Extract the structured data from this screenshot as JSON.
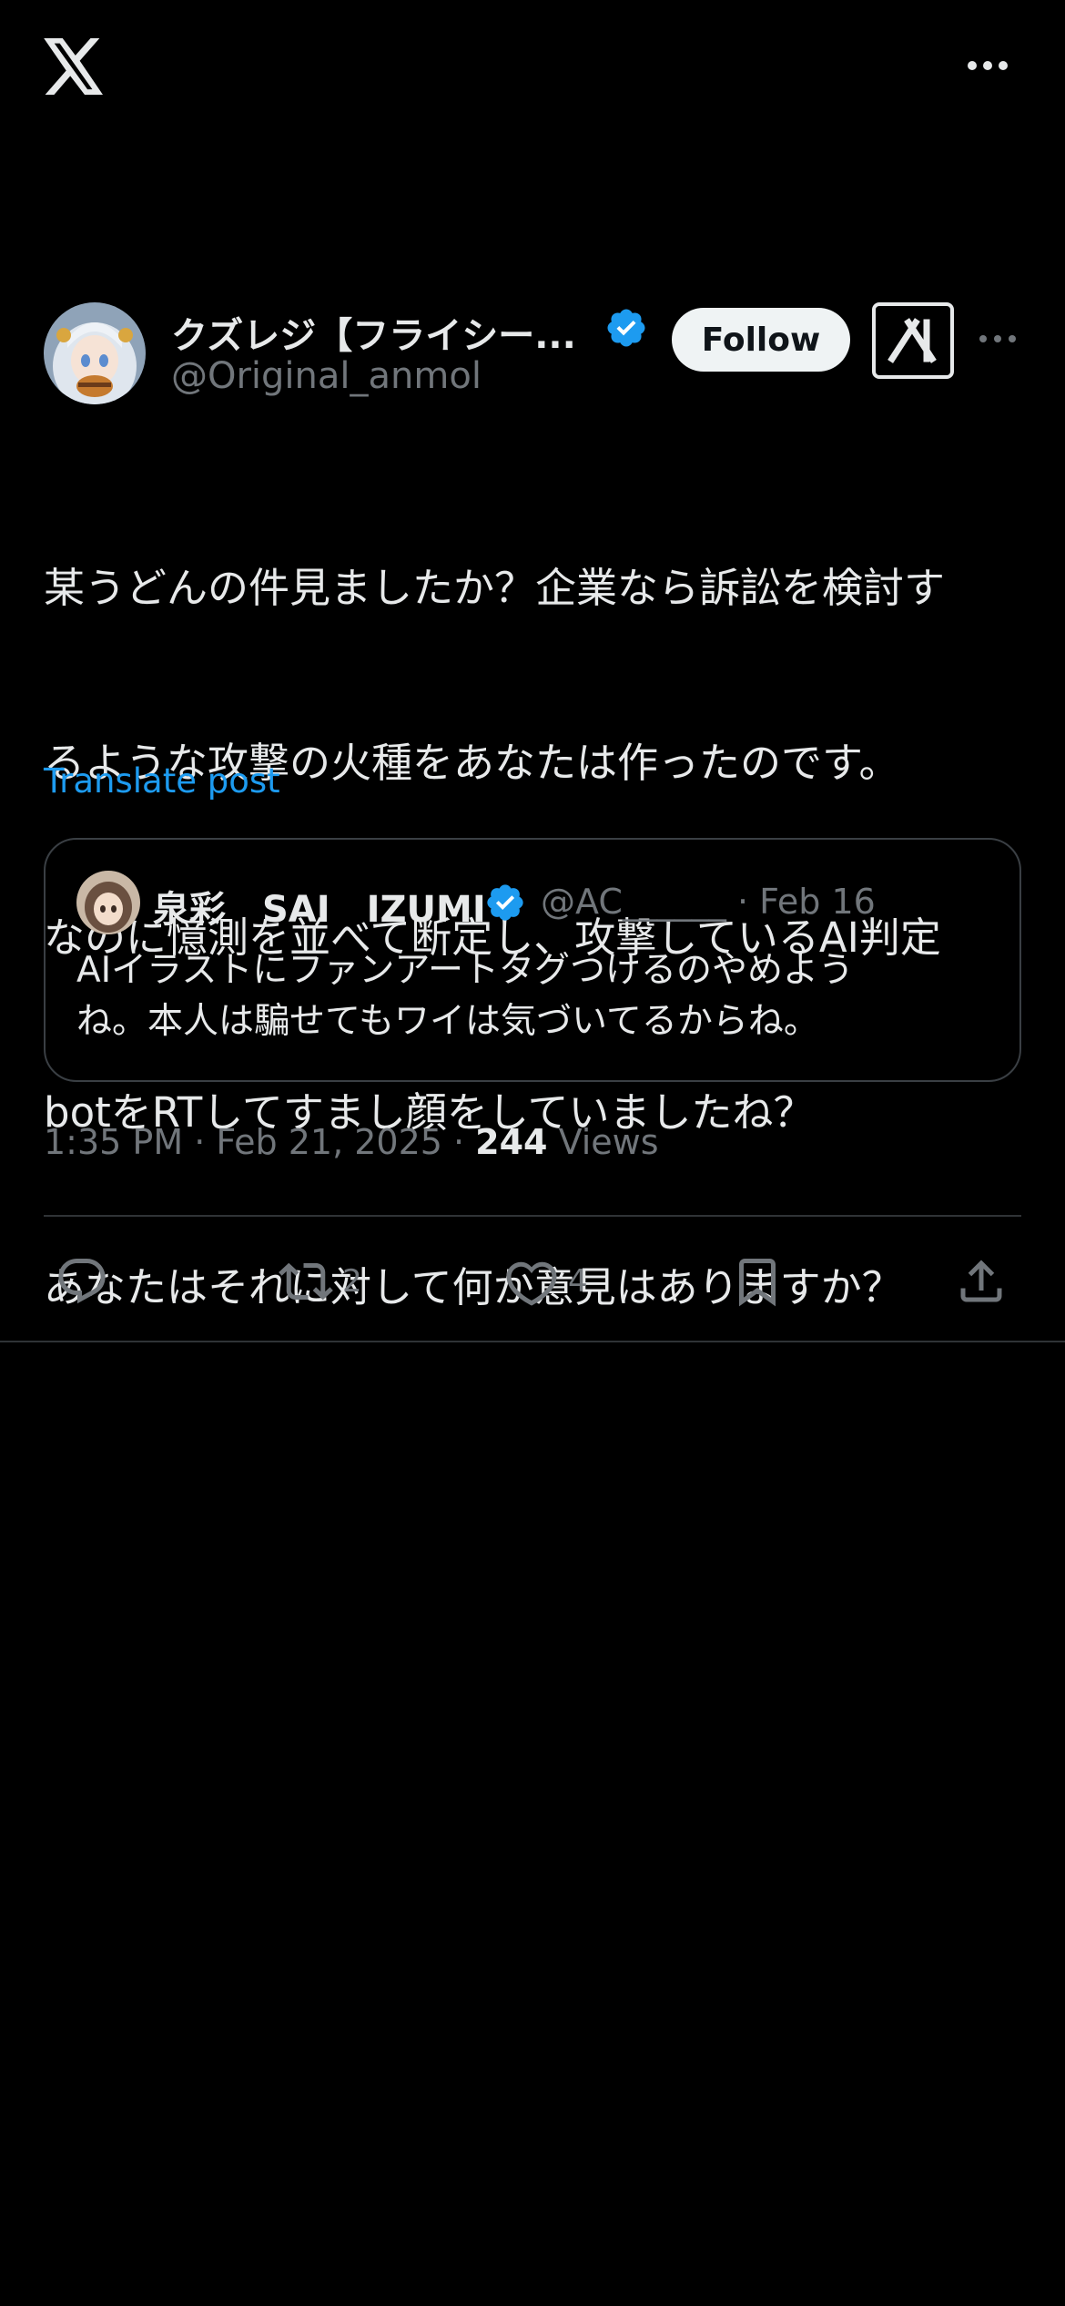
{
  "app": {
    "logo_icon": "x-logo-icon",
    "more_icon": "more-horizontal-icon"
  },
  "post": {
    "author": {
      "name": "クズレジ【フライシー...",
      "handle": "@Original_anmol",
      "verified": true,
      "avatar_icon": "avatar-anime-character"
    },
    "follow_label": "Follow",
    "grok_icon": "grok-icon",
    "text_lines": [
      "某うどんの件見ましたか？企業なら訴訟を検討す",
      "るような攻撃の火種をあなたは作ったのです。",
      "なのに憶測を並べて断定し、攻撃しているAI判定",
      "botをRTしてすまし顔をしていましたね？",
      "あなたはそれに対して何か意見はありますか？"
    ],
    "translate_label": "Translate post",
    "timestamp": "1:35 PM · Feb 21, 2025 · ",
    "views_count": "244",
    "views_label": " Views"
  },
  "quote": {
    "name": "泉彩　SAI　IZUMI",
    "verified": true,
    "handle": "@AC______",
    "date": "· Feb 16",
    "text_lines": [
      "AIイラストにファンアートタグつけるのやめよう",
      "ね。本人は騙せてもワイは気づいてるからね。"
    ]
  },
  "actions": {
    "reply": {
      "icon": "reply-icon",
      "count": ""
    },
    "repost": {
      "icon": "repost-icon",
      "count": "2"
    },
    "like": {
      "icon": "heart-icon",
      "count": "4"
    },
    "bookmark": {
      "icon": "bookmark-icon",
      "count": ""
    },
    "share": {
      "icon": "share-icon",
      "count": ""
    }
  },
  "colors": {
    "background": "#000000",
    "text_primary": "#e7e9ea",
    "text_secondary": "#71767b",
    "accent": "#1d9bf0",
    "divider": "#2f3336"
  }
}
